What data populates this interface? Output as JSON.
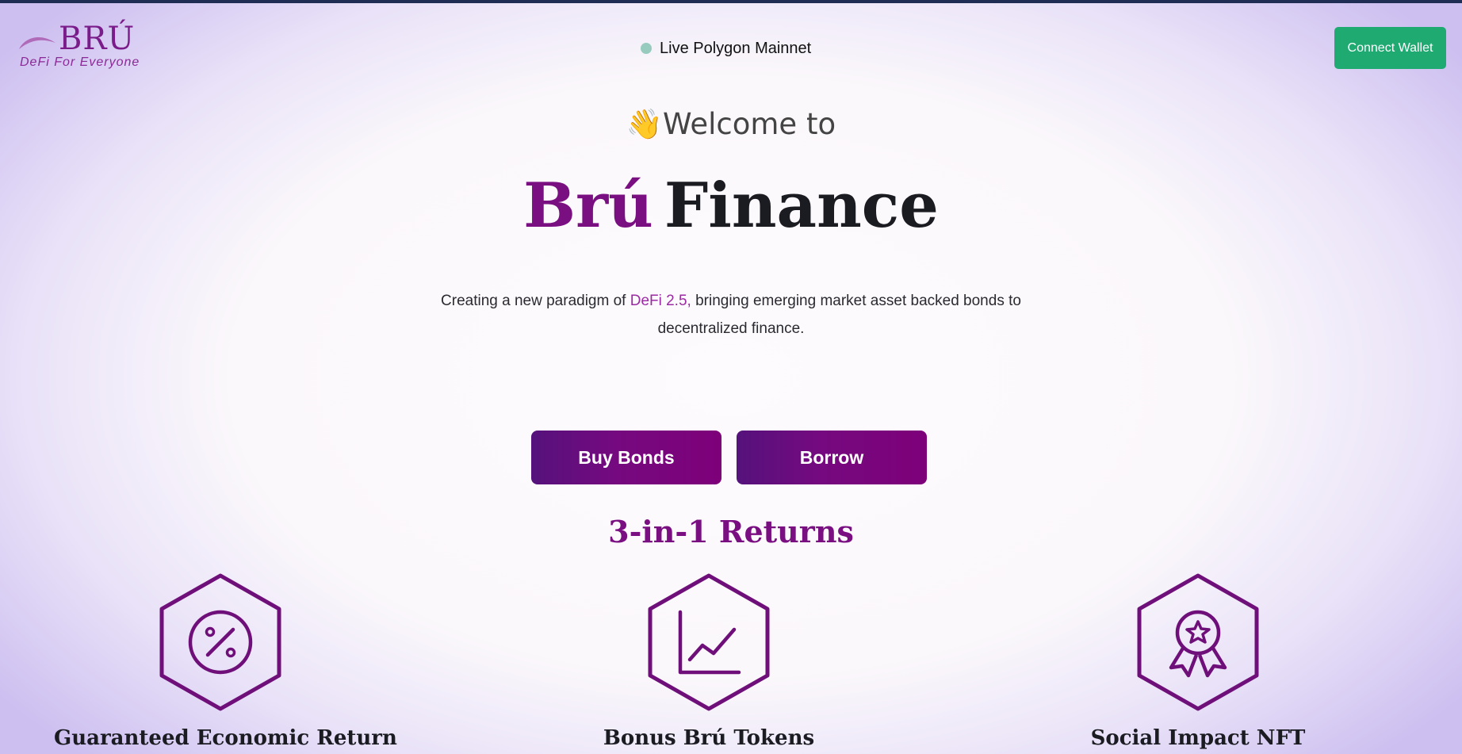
{
  "brand": {
    "logo_text": "BRÚ",
    "tagline": "DeFi For Everyone"
  },
  "network": {
    "status_label": "Live Polygon Mainnet",
    "status_color": "#96cbbd"
  },
  "header": {
    "connect_label": "Connect Wallet",
    "connect_color": "#1faa72"
  },
  "hero": {
    "wave_emoji": "👋",
    "welcome": "Welcome to",
    "brand_word": "Brú",
    "title_rest": "Finance",
    "desc_before": "Creating a new paradigm of ",
    "desc_highlight": "DeFi 2.5,",
    "desc_after": " bringing emerging market asset backed bonds to decentralized finance.",
    "accent_color": "#7a0f82"
  },
  "actions": {
    "buy_label": "Buy Bonds",
    "borrow_label": "Borrow"
  },
  "returns": {
    "title": "3-in-1 Returns",
    "items": [
      {
        "icon": "percent-icon",
        "label": "Guaranteed Economic Return"
      },
      {
        "icon": "chart-line-icon",
        "label": "Bonus Brú Tokens"
      },
      {
        "icon": "award-icon",
        "label": "Social Impact NFT"
      }
    ]
  }
}
